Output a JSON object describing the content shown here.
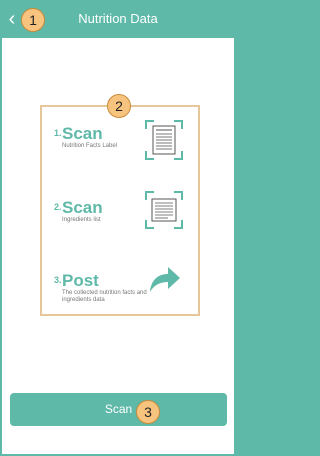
{
  "header": {
    "title": "Nutrition Data",
    "back_icon": "chevron-left-icon"
  },
  "markers": [
    "1",
    "2",
    "3"
  ],
  "steps": [
    {
      "number": "1.",
      "title": "Scan",
      "subtitle": "Nutrition Facts Label",
      "icon": "scan-label-icon"
    },
    {
      "number": "2.",
      "title": "Scan",
      "subtitle": "Ingredients list",
      "icon": "scan-list-icon"
    },
    {
      "number": "3.",
      "title": "Post",
      "subtitle": "The collected nutrition facts and ingredients data",
      "icon": "share-arrow-icon"
    }
  ],
  "scan_button": {
    "label": "Scan"
  },
  "colors": {
    "accent": "#5fb9a8",
    "marker": "#f7c47f",
    "card_border": "#e5c79a"
  }
}
